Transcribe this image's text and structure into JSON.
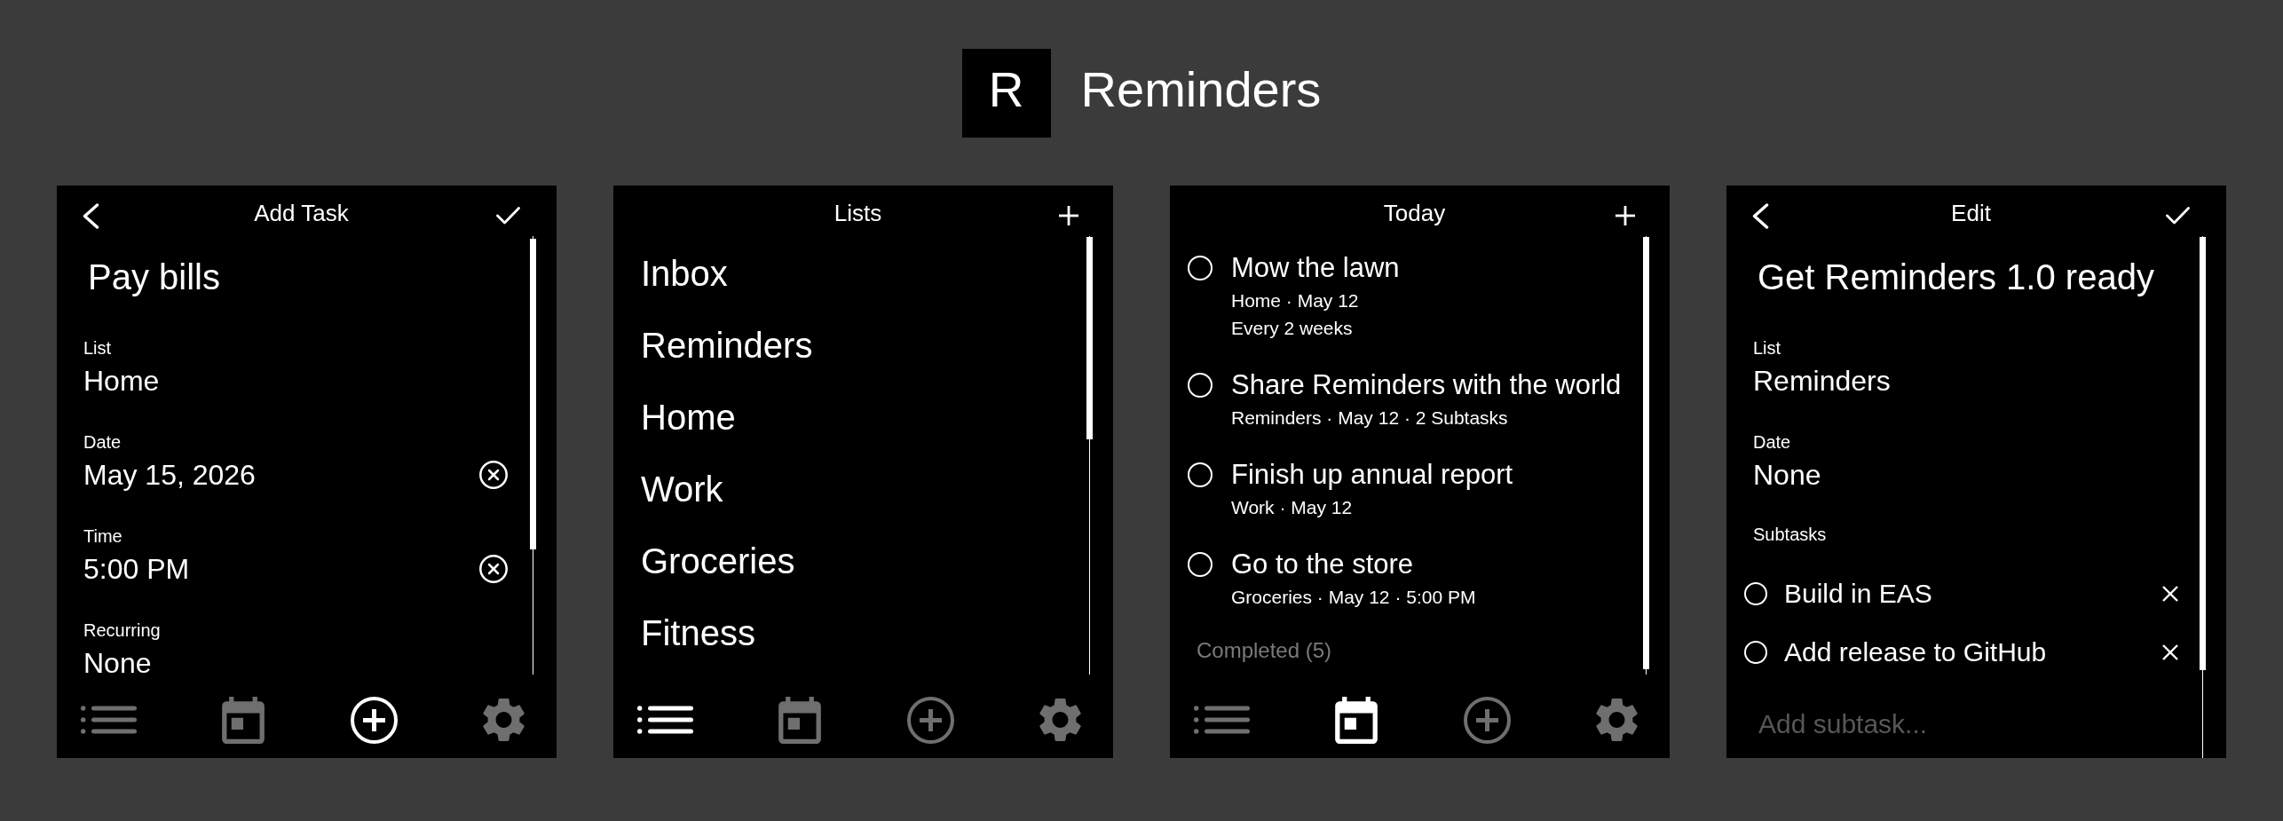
{
  "header": {
    "logo_letter": "R",
    "title": "Reminders"
  },
  "screens": [
    {
      "kind": "task_form",
      "title": "Add Task",
      "task_title": "Pay bills",
      "fields": [
        {
          "label": "List",
          "value": "Home",
          "clearable": false
        },
        {
          "label": "Date",
          "value": "May 15, 2026",
          "clearable": true
        },
        {
          "label": "Time",
          "value": "5:00 PM",
          "clearable": true
        },
        {
          "label": "Recurring",
          "value": "None",
          "clearable": false
        }
      ],
      "tab_bar": [
        {
          "kind": "lists",
          "selected": false
        },
        {
          "kind": "calendar",
          "selected": false
        },
        {
          "kind": "add",
          "selected": true
        },
        {
          "kind": "settings",
          "selected": false
        }
      ]
    },
    {
      "kind": "lists",
      "title": "Lists",
      "lists": [
        "Inbox",
        "Reminders",
        "Home",
        "Work",
        "Groceries",
        "Fitness"
      ],
      "tab_bar": [
        {
          "kind": "lists",
          "selected": true
        },
        {
          "kind": "calendar",
          "selected": false
        },
        {
          "kind": "add",
          "selected": false
        },
        {
          "kind": "settings",
          "selected": false
        }
      ]
    },
    {
      "kind": "tasks",
      "title": "Today",
      "tasks": [
        {
          "title": "Mow the lawn",
          "details": [
            "Home · May 12",
            "Every 2 weeks"
          ],
          "checked": false
        },
        {
          "title": "Share Reminders with the world",
          "details": [
            "Reminders · May 12 · 2 Subtasks"
          ],
          "checked": false
        },
        {
          "title": "Finish up annual report",
          "details": [
            "Work · May 12"
          ],
          "checked": false
        },
        {
          "title": "Go to the store",
          "details": [
            "Groceries · May 12 · 5:00 PM"
          ],
          "checked": false
        }
      ],
      "completed_label": "Completed (5)",
      "tab_bar": [
        {
          "kind": "lists",
          "selected": false
        },
        {
          "kind": "calendar",
          "selected": true
        },
        {
          "kind": "add",
          "selected": false
        },
        {
          "kind": "settings",
          "selected": false
        }
      ]
    },
    {
      "kind": "task_form",
      "title": "Edit",
      "task_title": "Get Reminders 1.0 ready",
      "fields": [
        {
          "label": "List",
          "value": "Reminders",
          "clearable": false
        },
        {
          "label": "Date",
          "value": "None",
          "clearable": false
        }
      ],
      "subtasks": {
        "label": "Subtasks",
        "items": [
          {
            "title": "Build in EAS",
            "checked": false
          },
          {
            "title": "Add release to GitHub",
            "checked": false
          }
        ],
        "placeholder": "Add subtask..."
      }
    }
  ]
}
